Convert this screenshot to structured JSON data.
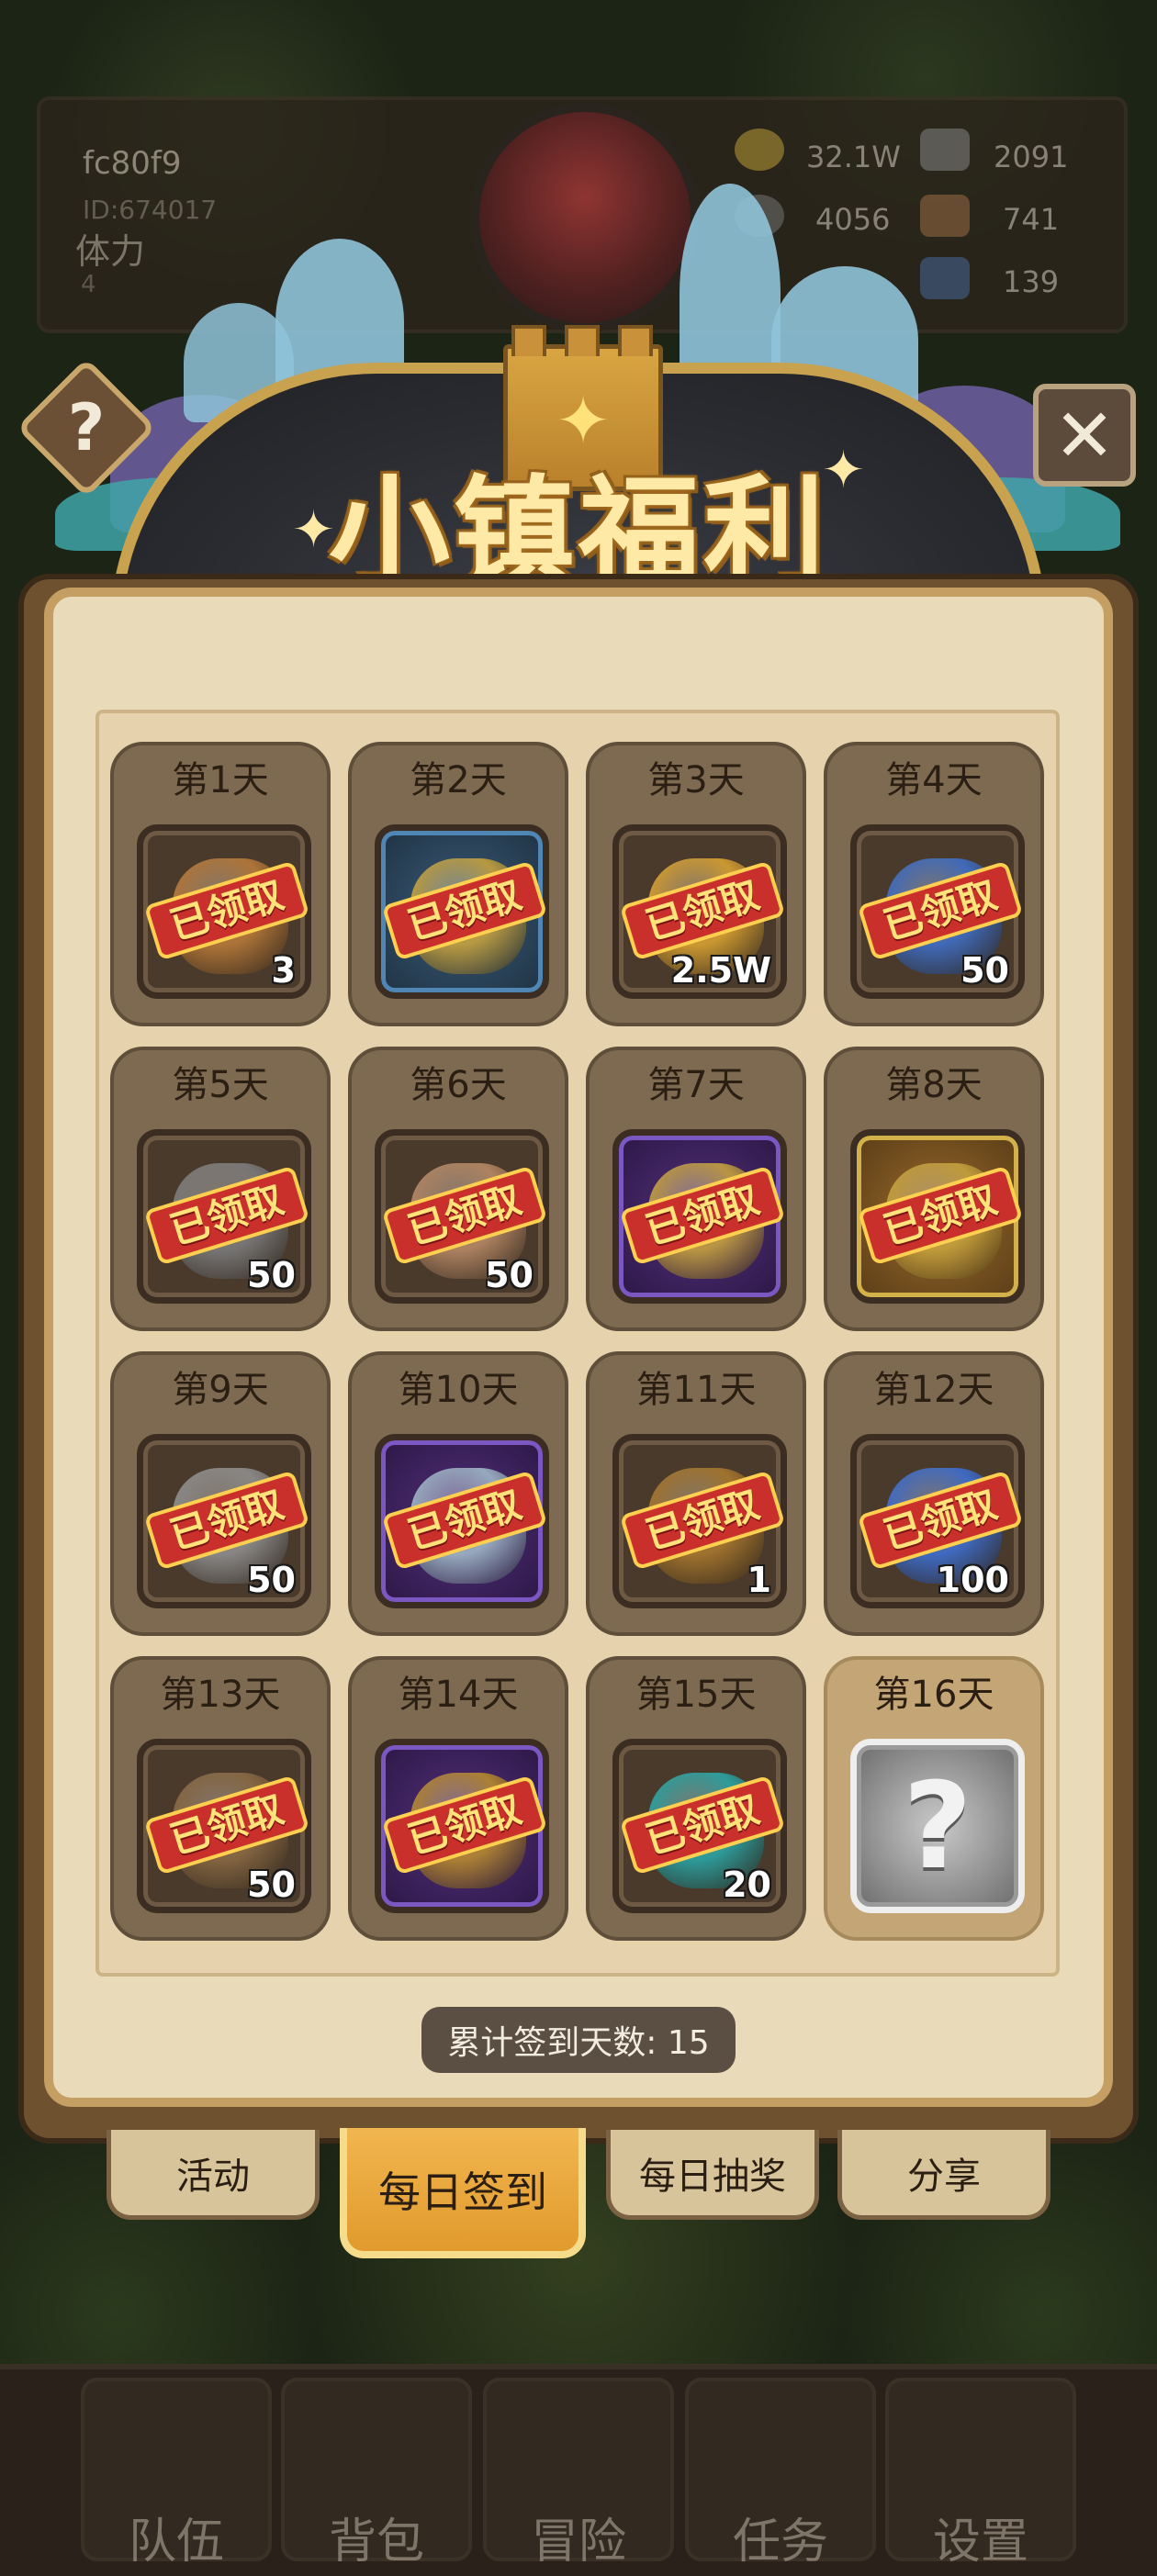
{
  "header": {
    "player_name": "fc80f9",
    "player_id": "ID:674017",
    "stamina_label": "体力",
    "stamina_value": "4",
    "resources": {
      "gold": "32.1W",
      "ore": "2091",
      "stone": "4056",
      "hide": "741",
      "gem": "139"
    }
  },
  "title": "小镇福利",
  "help_icon": "?",
  "close_icon": "✕",
  "claimed_stamp": "已领取",
  "days": [
    {
      "label": "第1天",
      "qty": "3",
      "slot": "plain",
      "art": "#b97b3a"
    },
    {
      "label": "第2天",
      "qty": "",
      "slot": "blue",
      "art": "#c6a23e"
    },
    {
      "label": "第3天",
      "qty": "2.5W",
      "slot": "plain",
      "art": "#d9a232"
    },
    {
      "label": "第4天",
      "qty": "50",
      "slot": "plain",
      "art": "#3f6fc7"
    },
    {
      "label": "第5天",
      "qty": "50",
      "slot": "plain",
      "art": "#7d7d7d"
    },
    {
      "label": "第6天",
      "qty": "50",
      "slot": "plain",
      "art": "#b88a66"
    },
    {
      "label": "第7天",
      "qty": "",
      "slot": "purple",
      "art": "#c6a23e"
    },
    {
      "label": "第8天",
      "qty": "",
      "slot": "gold",
      "art": "#c6a23e"
    },
    {
      "label": "第9天",
      "qty": "50",
      "slot": "plain",
      "art": "#8f8f8f"
    },
    {
      "label": "第10天",
      "qty": "",
      "slot": "purple",
      "art": "#9fb7c7"
    },
    {
      "label": "第11天",
      "qty": "1",
      "slot": "plain",
      "art": "#a8782e"
    },
    {
      "label": "第12天",
      "qty": "100",
      "slot": "plain",
      "art": "#3e6fd1"
    },
    {
      "label": "第13天",
      "qty": "50",
      "slot": "plain",
      "art": "#8a6a44"
    },
    {
      "label": "第14天",
      "qty": "",
      "slot": "purple",
      "art": "#b88a2e"
    },
    {
      "label": "第15天",
      "qty": "20",
      "slot": "plain",
      "art": "#2aa6a6"
    },
    {
      "label": "第16天",
      "qty": "",
      "slot": "silver",
      "art": "",
      "claimed": false
    }
  ],
  "counter": "累计签到天数: 15",
  "tabs": {
    "activity": "活动",
    "daily_checkin": "每日签到",
    "daily_lottery": "每日抽奖",
    "share": "分享"
  },
  "nav": {
    "team": "队伍",
    "bag": "背包",
    "adventure": "冒险",
    "quest": "任务",
    "settings": "设置"
  },
  "colors": {
    "accent": "#e19a2d",
    "stamp": "#c9302c",
    "panel": "#e9dbb9"
  }
}
